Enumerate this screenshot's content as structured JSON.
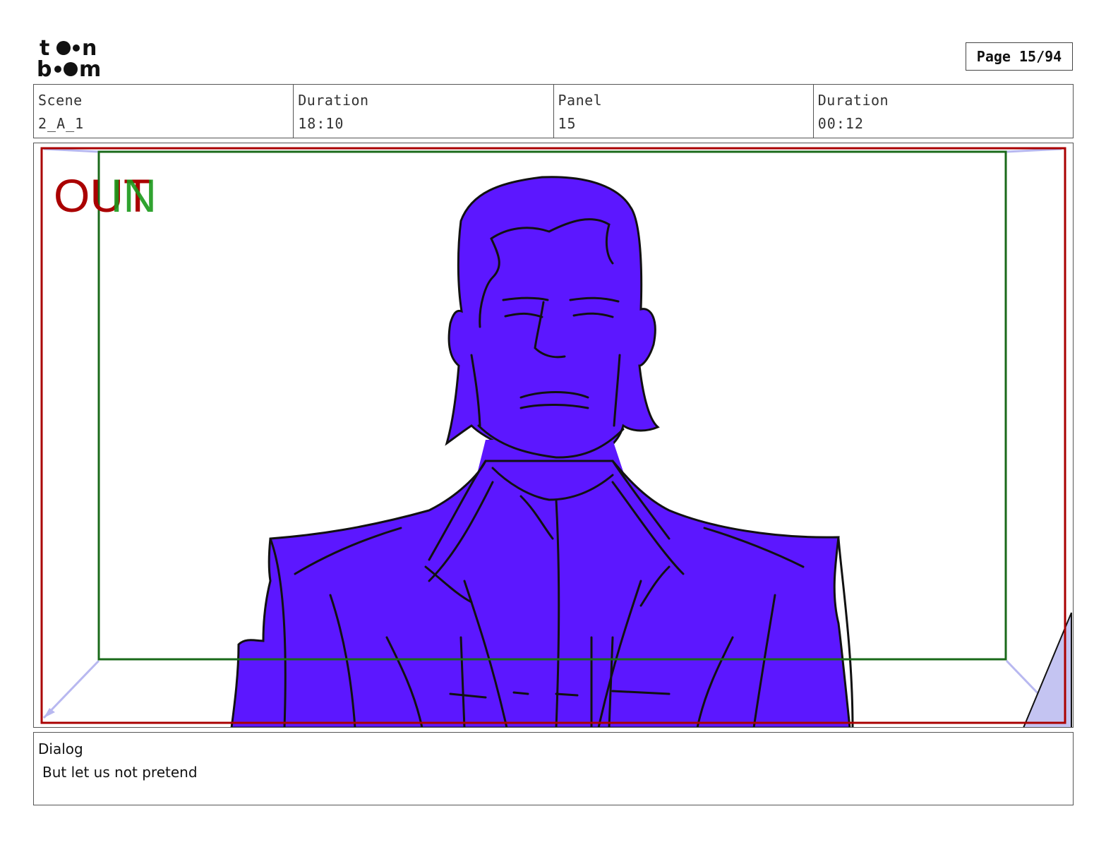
{
  "logo": {
    "line1": "toon",
    "line2": "boom"
  },
  "page": {
    "label": "Page 15/94"
  },
  "info": {
    "scene_label": "Scene",
    "scene_value": "2_A_1",
    "scene_duration_label": "Duration",
    "scene_duration_value": "18:10",
    "panel_label": "Panel",
    "panel_value": "15",
    "panel_duration_label": "Duration",
    "panel_duration_value": "00:12"
  },
  "frame": {
    "out_label": "OUT",
    "in_label": "IN",
    "out_color": "#aa0000",
    "in_color": "#1a7a1a",
    "fill_color": "#5c17ff"
  },
  "dialog": {
    "label": "Dialog",
    "text": "But let us not pretend"
  }
}
